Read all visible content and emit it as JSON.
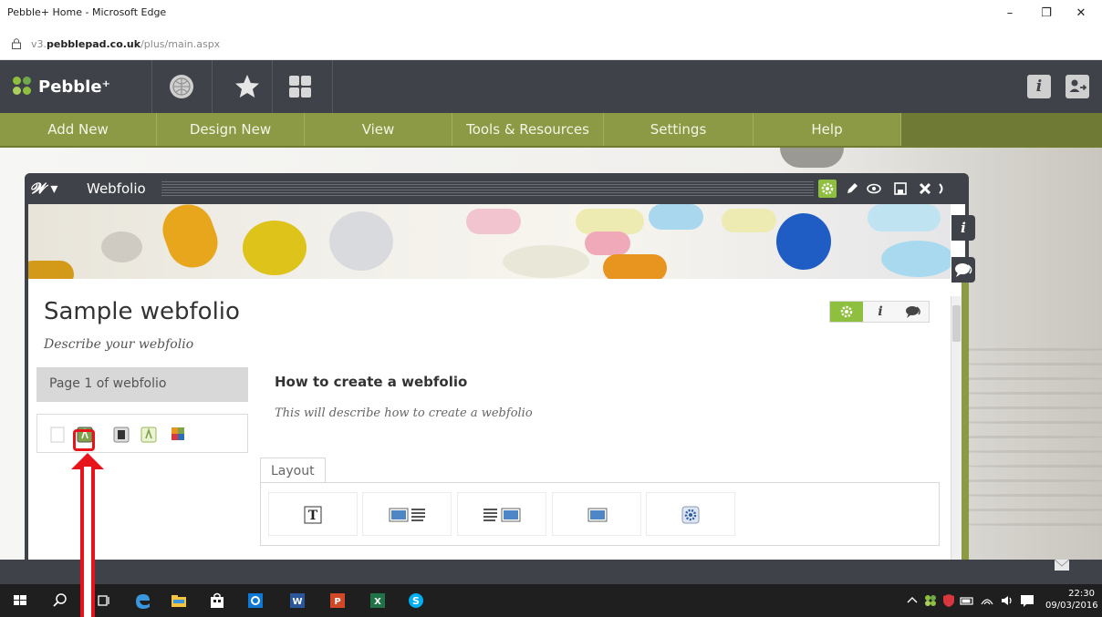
{
  "window": {
    "title": "Pebble+ Home - Microsoft Edge",
    "minimize": "–",
    "restore": "❐",
    "close": "✕"
  },
  "address": {
    "url_prefix": "v3.",
    "url_domain": "pebblepad.co.uk",
    "url_path": "/plus/main.aspx"
  },
  "app": {
    "logo_text": "Pebble⁺",
    "info_button": "i"
  },
  "menu": {
    "items": [
      "Add New",
      "Design New",
      "View",
      "Tools & Resources",
      "Settings",
      "Help"
    ]
  },
  "webfolio": {
    "window_title": "Webfolio",
    "page_title": "Sample webfolio",
    "page_description": "Describe your webfolio",
    "page_nav_label": "Page 1 of webfolio",
    "section_title": "How to create a webfolio",
    "section_description": "This will describe how to create a webfolio",
    "layout_tab": "Layout",
    "side_info": "i",
    "trio_info": "i"
  },
  "taskbar": {
    "time": "22:30",
    "date": "09/03/2016"
  },
  "colors": {
    "pebble_dark": "#3f4248",
    "menu_green": "#8c9a46",
    "annotation_red": "#e8141b"
  }
}
